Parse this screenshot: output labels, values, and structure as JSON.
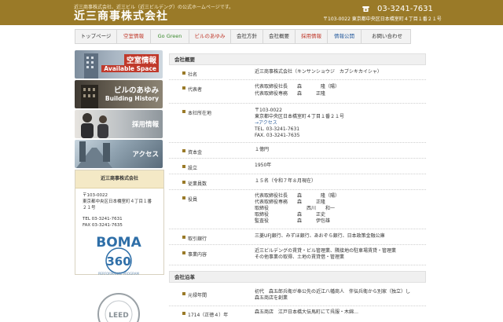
{
  "header": {
    "tagline": "近三商事株式会社、近三ビル（近三ビルデング）の公式ホームページです。",
    "title": "近三商事株式会社",
    "phone": "03-3241-7631",
    "address": "〒103-0022 東京都中央区日本橋室町４丁目１番２１号",
    "bg_color": "#9a7a28"
  },
  "nav": {
    "items": [
      {
        "label": "トップページ",
        "color": "#333333"
      },
      {
        "label": "空室情報",
        "color": "#c0392b"
      },
      {
        "label": "Go Green",
        "color": "#3a8a2e"
      },
      {
        "label": "ビルのあゆみ",
        "color": "#c0392b"
      },
      {
        "label": "会社方針",
        "color": "#333333"
      },
      {
        "label": "会社概要",
        "color": "#333333"
      },
      {
        "label": "採用情報",
        "color": "#c0392b"
      },
      {
        "label": "情報公開",
        "color": "#2b5fa0"
      },
      {
        "label": "お問い合わせ",
        "color": "#333333"
      }
    ]
  },
  "sidebar": {
    "banners": [
      {
        "ja": "空室情報",
        "en": "Available Space",
        "icon": "building-icon"
      },
      {
        "ja": "ビルのあゆみ",
        "en": "Building History",
        "icon": "old-building-icon"
      },
      {
        "ja": "採用情報",
        "en": "",
        "icon": "business-people-icon"
      },
      {
        "ja": "アクセス",
        "en": "",
        "icon": "city-street-icon"
      }
    ],
    "infobox": {
      "title": "近三商事株式会社",
      "lines": [
        "〒103-0022",
        "東京都中央区日本橋室町４丁目１番",
        "２１号",
        "",
        "TEL 03-3241-7631",
        "FAX 03-3241-7635"
      ]
    },
    "boma": {
      "name": "BOMA",
      "num": "360",
      "sub": "PERFORMANCE PROGRAM"
    },
    "leed": {
      "name": "LEED"
    }
  },
  "overview": {
    "heading": "会社概要",
    "rows": [
      {
        "label": "社名",
        "lines": [
          "近三商事株式会社（キンサンショウジ　カブシキカイシャ）"
        ]
      },
      {
        "label": "代表者",
        "lines": [
          "代表取締役社長　　森　　　　隆（陽）",
          "代表取締役専務　　森　　　正隆"
        ]
      },
      {
        "label": "本社所在地",
        "lines": [
          "〒103-0022",
          "東京都中央区日本橋室町４丁目１番２１号",
          "→アクセス",
          "TEL. 03-3241-7631",
          "FAX. 03-3241-7635"
        ]
      },
      {
        "label": "資本金",
        "lines": [
          "１億円"
        ]
      },
      {
        "label": "設立",
        "lines": [
          "1950年"
        ]
      },
      {
        "label": "従業員数",
        "lines": [
          "１５名（令和７年８月現在）"
        ]
      },
      {
        "label": "役員",
        "lines": [
          "代表取締役社長　　森　　　　隆（陽）",
          "代表取締役専務　　森　　　正隆",
          "取締役　　　　　　　　西川　　和一",
          "取締役　　　　　　森　　　正史",
          "監査役　　　　　　森　　　伊包雄"
        ]
      },
      {
        "label": "取引銀行",
        "lines": [
          "三菱UFJ銀行、みずほ銀行、あおぞら銀行、日本政策金融公庫"
        ]
      },
      {
        "label": "事業内容",
        "lines": [
          "近三ビルデングの賃貸・ビル管理業、隣接地の駐車場賃貸・管理業",
          "その他事業の取得、土地の賃貸借・管理業"
        ]
      }
    ]
  },
  "history": {
    "heading": "会社沿革",
    "rows": [
      {
        "label": "元禄年間",
        "lines": [
          "初代　森五郎兵衛が奉公先の近江八幡商人　伴伝兵衛から別家（独立）し",
          "森五商店を創業"
        ]
      },
      {
        "label": "1714（正徳４）年",
        "lines": [
          "森五商店　江戸日本橋大伝馬町にて呉服・木綿…"
        ]
      }
    ]
  }
}
